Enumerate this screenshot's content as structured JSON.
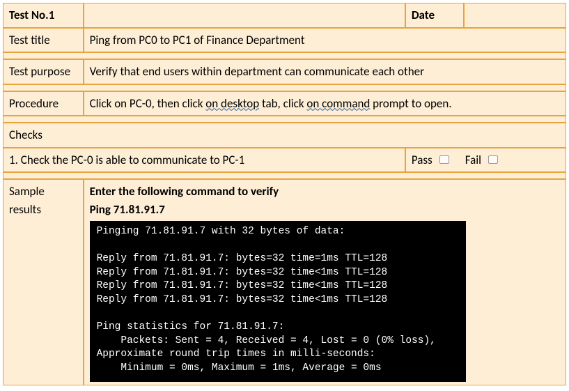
{
  "header": {
    "test_no_label": "Test No.1",
    "date_label": "Date",
    "date_value": ""
  },
  "rows": {
    "title_label": "Test title",
    "title_value": "Ping from PC0 to PC1 of Finance Department",
    "purpose_label": "Test purpose",
    "purpose_value": "Verify that end users within department can communicate each other",
    "procedure_label": "Procedure",
    "procedure_prefix": "Click on PC-0, then click ",
    "procedure_wavy1": "on desktop",
    "procedure_mid": " tab, click ",
    "procedure_wavy2": "on command",
    "procedure_suffix": " prompt to open."
  },
  "checks": {
    "header": "Checks",
    "item1": "1.  Check the PC-0 is able to communicate to PC-1",
    "pass_label": "Pass",
    "fail_label": "Fail"
  },
  "sample": {
    "label": "Sample results",
    "instruction": "Enter the following command to verify",
    "command": "Ping 71.81.91.7",
    "terminal": "Pinging 71.81.91.7 with 32 bytes of data:\n\nReply from 71.81.91.7: bytes=32 time=1ms TTL=128\nReply from 71.81.91.7: bytes=32 time<1ms TTL=128\nReply from 71.81.91.7: bytes=32 time<1ms TTL=128\nReply from 71.81.91.7: bytes=32 time<1ms TTL=128\n\nPing statistics for 71.81.91.7:\n    Packets: Sent = 4, Received = 4, Lost = 0 (0% loss),\nApproximate round trip times in milli-seconds:\n    Minimum = 0ms, Maximum = 1ms, Average = 0ms"
  }
}
